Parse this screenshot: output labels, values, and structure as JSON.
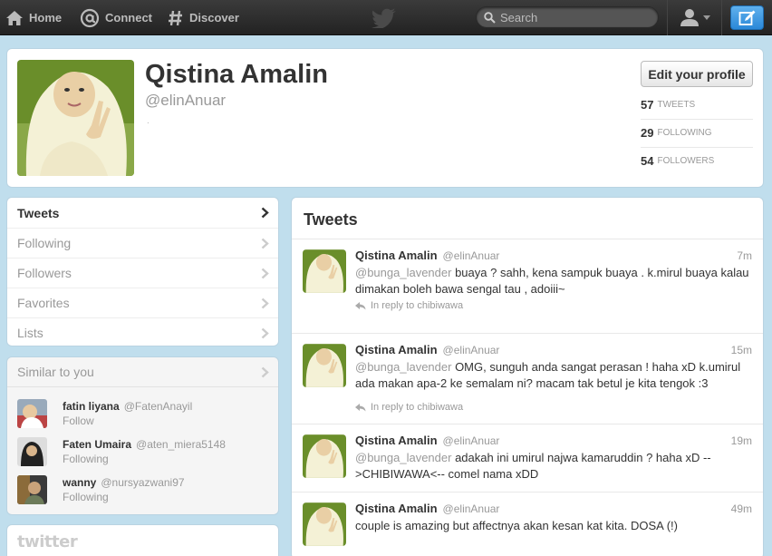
{
  "topbar": {
    "home_label": "Home",
    "connect_label": "Connect",
    "discover_label": "Discover",
    "search_placeholder": "Search"
  },
  "profile": {
    "name": "Qistina Amalin",
    "handle": "@elinAnuar",
    "dot": ".",
    "edit_label": "Edit your profile",
    "stats": [
      {
        "count": "57",
        "label": "TWEETS"
      },
      {
        "count": "29",
        "label": "FOLLOWING"
      },
      {
        "count": "54",
        "label": "FOLLOWERS"
      }
    ]
  },
  "leftnav": {
    "items": [
      {
        "label": "Tweets"
      },
      {
        "label": "Following"
      },
      {
        "label": "Followers"
      },
      {
        "label": "Favorites"
      },
      {
        "label": "Lists"
      }
    ]
  },
  "similar": {
    "title": "Similar to you",
    "users": [
      {
        "name": "fatin liyana",
        "handle": "@FatenAnayil",
        "action": "Follow"
      },
      {
        "name": "Faten Umaira",
        "handle": "@aten_miera5148",
        "action": "Following"
      },
      {
        "name": "wanny",
        "handle": "@nursyazwani97",
        "action": "Following"
      }
    ]
  },
  "footer": {
    "logo": "twitter"
  },
  "tweets": {
    "title": "Tweets",
    "items": [
      {
        "name": "Qistina Amalin",
        "handle": "@elinAnuar",
        "time": "7m",
        "mention": "@bunga_lavender",
        "text": " buaya ? sahh, kena sampuk buaya . k.mirul buaya kalau dimakan boleh bawa sengal tau , adoiii~",
        "reply": "In reply to chibiwawa"
      },
      {
        "name": "Qistina Amalin",
        "handle": "@elinAnuar",
        "time": "15m",
        "mention": "@bunga_lavender",
        "text": " OMG, sunguh anda sangat perasan ! haha xD k.umirul ada makan apa-2 ke semalam ni? macam tak betul je kita tengok :3",
        "reply": "In reply to chibiwawa"
      },
      {
        "name": "Qistina Amalin",
        "handle": "@elinAnuar",
        "time": "19m",
        "mention": "@bunga_lavender",
        "text": " adakah ini umirul najwa kamaruddin ? haha xD -- >CHIBIWAWA<-- comel nama xDD",
        "reply": ""
      },
      {
        "name": "Qistina Amalin",
        "handle": "@elinAnuar",
        "time": "49m",
        "mention": "",
        "text": "couple is amazing but affectnya akan kesan kat kita. DOSA (!)",
        "reply": ""
      }
    ]
  }
}
